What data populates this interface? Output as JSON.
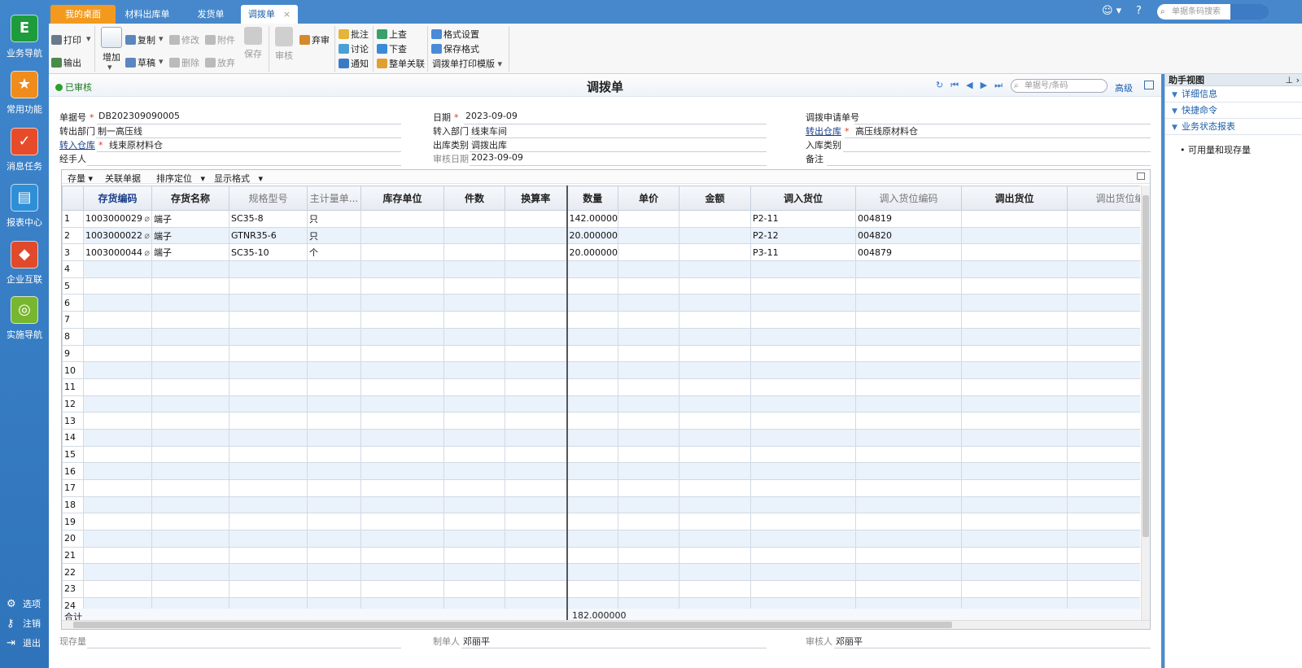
{
  "sidebar": {
    "items": [
      {
        "label": "业务导航",
        "icon": "business-nav-icon",
        "color": "#1e9b3a",
        "glyph": "E"
      },
      {
        "label": "常用功能",
        "icon": "star-icon",
        "color": "#f08c1c",
        "glyph": "★"
      },
      {
        "label": "消息任务",
        "icon": "task-check-icon",
        "color": "#e64b2a",
        "glyph": "✓"
      },
      {
        "label": "报表中心",
        "icon": "report-icon",
        "color": "#2f8fd6",
        "glyph": "▤"
      },
      {
        "label": "企业互联",
        "icon": "enterprise-link-icon",
        "color": "#e04a2b",
        "glyph": "◆"
      },
      {
        "label": "实施导航",
        "icon": "compass-icon",
        "color": "#79b630",
        "glyph": "◎"
      }
    ],
    "bottom": [
      {
        "label": "选项",
        "icon": "gear-icon",
        "glyph": "⚙"
      },
      {
        "label": "注销",
        "icon": "key-icon",
        "glyph": "⚷"
      },
      {
        "label": "退出",
        "icon": "exit-icon",
        "glyph": "⇥"
      }
    ]
  },
  "tabs": [
    {
      "label": "我的桌面"
    },
    {
      "label": "材料出库单"
    },
    {
      "label": "发货单"
    },
    {
      "label": "调拨单",
      "close": "×"
    }
  ],
  "top_search": {
    "placeholder": "单据条码搜索"
  },
  "toolbar": {
    "print": "打印",
    "export": "输出",
    "add": "增加",
    "copy": "复制",
    "draft": "草稿",
    "modify": "修改",
    "delete": "删除",
    "attach": "附件",
    "abandon": "放弃",
    "save": "保存",
    "review": "审核",
    "unreview": "弃审",
    "annotate": "批注",
    "discuss": "讨论",
    "notify": "通知",
    "prev_lookup": "上查",
    "next_lookup": "下查",
    "whole_link": "整单关联",
    "format_settings": "格式设置",
    "save_format": "保存格式",
    "print_template": "调拨单打印模版"
  },
  "doc": {
    "status": "已审核",
    "title": "调拨单",
    "search_placeholder": "单据号/条码",
    "advanced": "高级",
    "fields": {
      "doc_no_label": "单据号",
      "doc_no": "DB202309090005",
      "date_label": "日期",
      "date": "2023-09-09",
      "apply_no_label": "调拨申请单号",
      "apply_no": "",
      "out_dept_label": "转出部门",
      "out_dept": "制一高压线",
      "in_dept_label": "转入部门",
      "in_dept": "线束车间",
      "out_wh_label": "转出仓库",
      "out_wh": "高压线原材料仓",
      "in_wh_label": "转入仓库",
      "in_wh": "线束原材料仓",
      "out_type_label": "出库类别",
      "out_type": "调拨出库",
      "in_type_label": "入库类别",
      "in_type": "",
      "handler_label": "经手人",
      "handler": "",
      "review_date_label": "审核日期",
      "review_date": "2023-09-09",
      "remark_label": "备注",
      "remark": ""
    },
    "footer": {
      "stock_label": "现存量",
      "stock": "",
      "maker_label": "制单人",
      "maker": "邓丽平",
      "reviewer_label": "审核人",
      "reviewer": "邓丽平"
    }
  },
  "grid_toolbar": {
    "stock": "存量",
    "related": "关联单据",
    "sort": "排序定位",
    "display": "显示格式"
  },
  "grid": {
    "headers": [
      "存货编码",
      "存货名称",
      "规格型号",
      "主计量单...",
      "库存单位",
      "件数",
      "换算率",
      "数量",
      "单价",
      "金额",
      "调入货位",
      "调入货位编码",
      "调出货位",
      "调出货位编"
    ],
    "rows": [
      {
        "no": "1",
        "code": "1003000029",
        "name": "端子",
        "spec": "SC35-8",
        "unit": "只",
        "qty": "142.000000",
        "in_loc": "P2-11",
        "in_loc_code": "004819"
      },
      {
        "no": "2",
        "code": "1003000022",
        "name": "端子",
        "spec": "GTNR35-6",
        "unit": "只",
        "qty": "20.000000",
        "in_loc": "P2-12",
        "in_loc_code": "004820"
      },
      {
        "no": "3",
        "code": "1003000044",
        "name": "端子",
        "spec": "SC35-10",
        "unit": "个",
        "qty": "20.000000",
        "in_loc": "P3-11",
        "in_loc_code": "004879"
      }
    ],
    "empty_rows": [
      "4",
      "5",
      "6",
      "7",
      "8",
      "9",
      "10",
      "11",
      "12",
      "13",
      "14",
      "15",
      "16",
      "17",
      "18",
      "19",
      "20",
      "21",
      "22",
      "23",
      "24"
    ],
    "total_label": "合计",
    "total_qty": "182.000000"
  },
  "helper": {
    "title": "助手视图",
    "sections": [
      "详细信息",
      "快捷命令",
      "业务状态报表"
    ],
    "items": [
      "可用量和现存量"
    ]
  }
}
